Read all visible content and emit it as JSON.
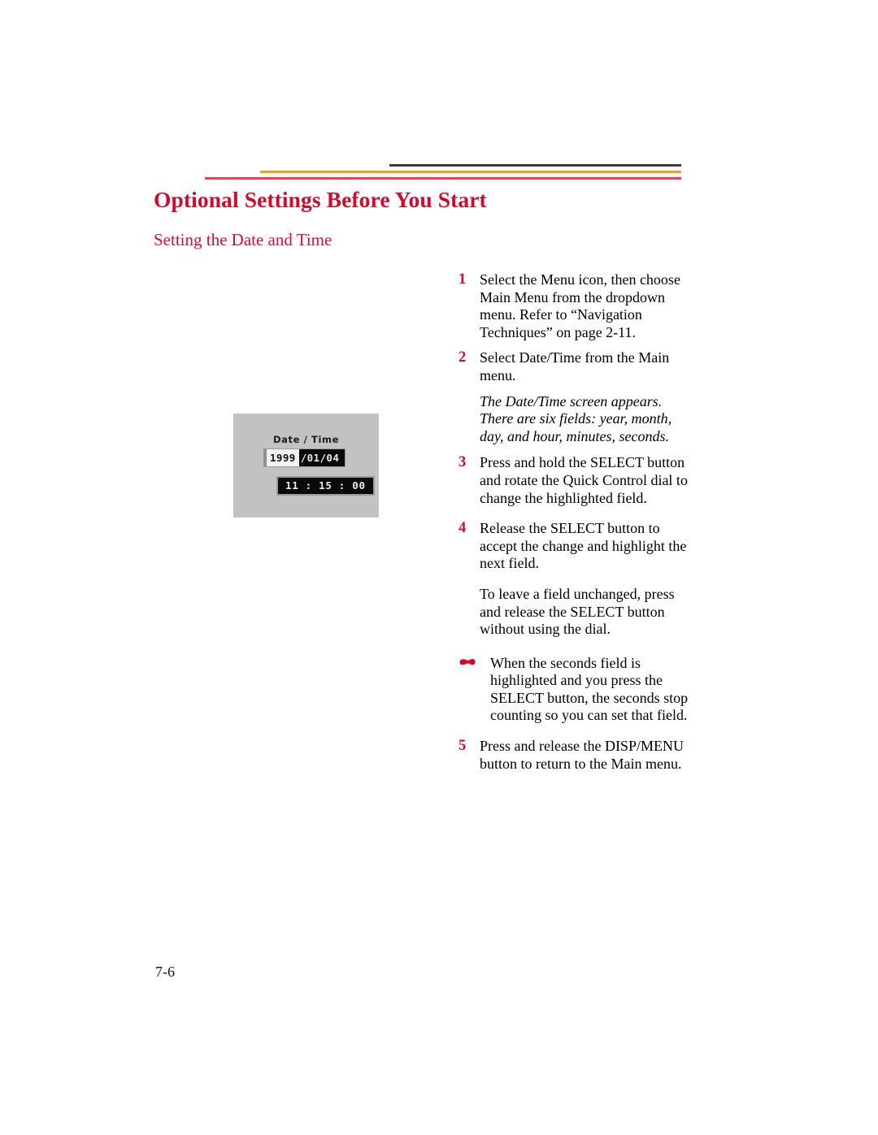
{
  "header": {
    "rules": [
      {
        "name": "dark-rule",
        "color": "#3d3d3d"
      },
      {
        "name": "orange-rule",
        "color": "#f9a01b"
      },
      {
        "name": "red-rule",
        "color": "#ef3e56"
      }
    ]
  },
  "page_title": "Optional Settings Before You Start",
  "section_title": "Setting the Date and Time",
  "figure": {
    "label": "Date / Time",
    "date_year": "1999",
    "date_rest": "/01/04",
    "time": "11 : 15 : 00"
  },
  "steps": [
    {
      "num": "1",
      "text": "Select the Menu icon, then choose Main Menu from the dropdown menu. Refer to “Navigation Techniques” on page 2-11."
    },
    {
      "num": "2",
      "text": "Select Date/Time from the Main menu."
    },
    {
      "num": "3",
      "text": "Press and hold the SELECT button and rotate the Quick Control dial to change the highlighted field."
    },
    {
      "num": "4",
      "text": "Release the SELECT button to accept the change and highlight the next field."
    },
    {
      "num": "5",
      "text": "Press and release the DISP/MENU button to return to the Main menu."
    }
  ],
  "italic_note": "The Date/Time screen appears. There are six fields: year, month, day, and hour, minutes, seconds.",
  "unchanged_note": "To leave a field unchanged, press and release the SELECT button without using the dial.",
  "tip": {
    "icon": "pointing-hand-icon",
    "text": "When the seconds field is highlighted and you press the SELECT button, the seconds stop counting so you can set that field."
  },
  "page_number": "7-6"
}
